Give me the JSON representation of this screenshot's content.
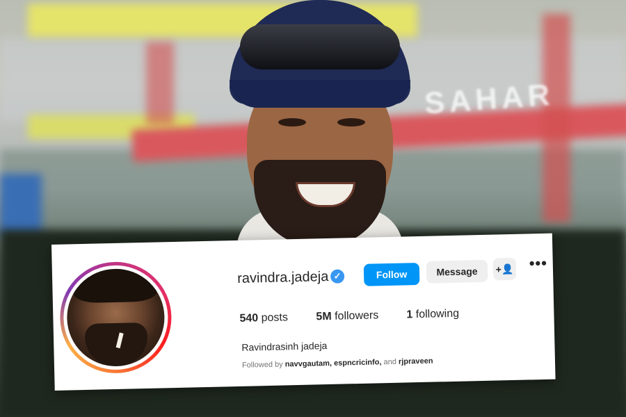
{
  "background": {
    "sponsor_text": "SAHAR",
    "colors": {
      "field": "#1f281f",
      "banner_red": "#d9585d",
      "banner_yellow": "#e4e36a"
    }
  },
  "profile": {
    "username": "ravindra.jadeja",
    "verified_icon": "verified-badge-icon",
    "follow_label": "Follow",
    "message_label": "Message",
    "add_user_icon": "+",
    "more_icon": "•••",
    "stats": {
      "posts_count": "540",
      "posts_label": "posts",
      "followers_count": "5M",
      "followers_label": "followers",
      "following_count": "1",
      "following_label": "following"
    },
    "full_name": "Ravindrasinh jadeja",
    "followed_by_prefix": "Followed by",
    "followed_by_users": "navvgautam, espncricinfo,",
    "followed_by_and": "and",
    "followed_by_last": "rjpraveen"
  },
  "colors": {
    "follow_button": "#0095f6",
    "verified": "#3897f0",
    "text": "#262626",
    "muted": "#737373"
  }
}
